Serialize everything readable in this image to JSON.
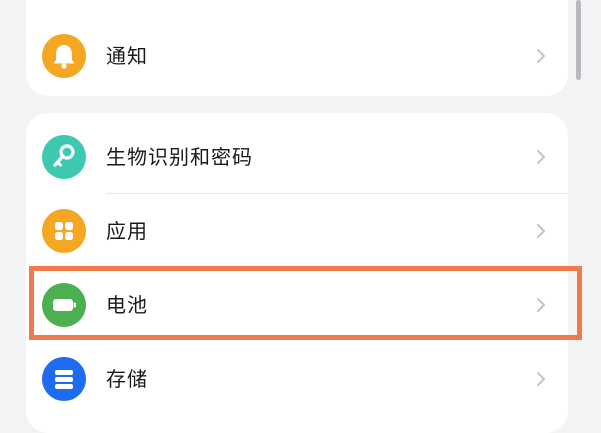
{
  "settings": {
    "group1": {
      "items": [
        {
          "label": "通知",
          "icon": "bell-icon",
          "color": "#f5a623"
        }
      ]
    },
    "group2": {
      "items": [
        {
          "label": "生物识别和密码",
          "icon": "key-icon",
          "color": "#3dc9b0"
        },
        {
          "label": "应用",
          "icon": "apps-grid-icon",
          "color": "#f5a623"
        },
        {
          "label": "电池",
          "icon": "battery-icon",
          "color": "#4caf50",
          "highlighted": true
        },
        {
          "label": "存储",
          "icon": "storage-icon",
          "color": "#1e6cf0"
        }
      ]
    }
  },
  "highlight_color": "#f07a4a"
}
